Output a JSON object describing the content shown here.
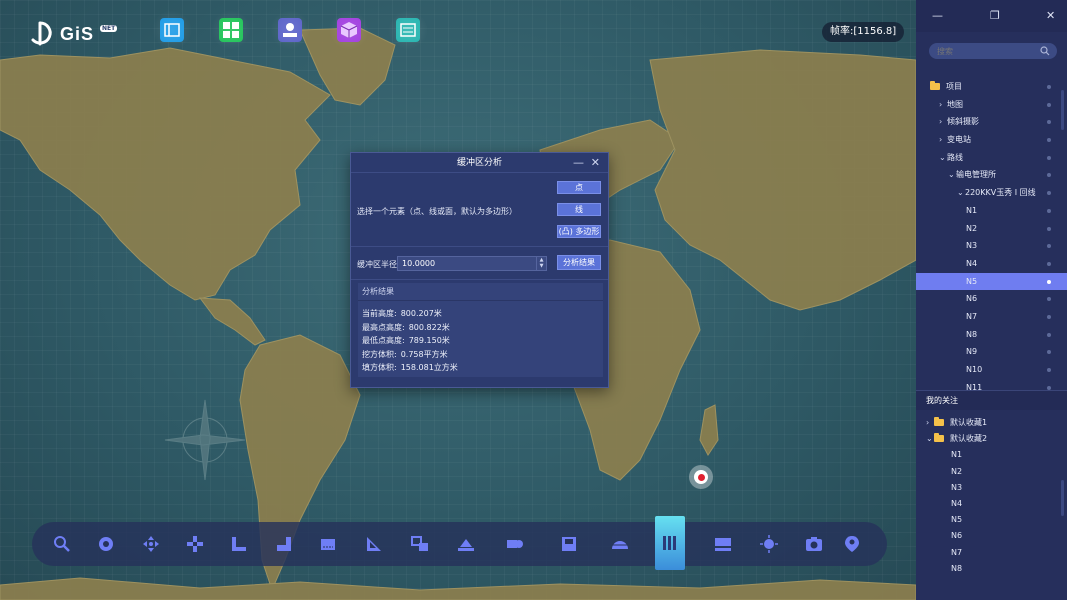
{
  "app": {
    "logo_text": "GiS",
    "logo_badge": "NET",
    "fps_label": "帧率:",
    "fps_value": "[1156.8]"
  },
  "top_icons": [
    {
      "name": "layer-panel-icon",
      "color": "#1d9be6"
    },
    {
      "name": "grid-apps-icon",
      "color": "#22c45a"
    },
    {
      "name": "map-marker-layer-icon",
      "color": "#5b63c9"
    },
    {
      "name": "cube-3d-icon",
      "color": "#a23fe0"
    },
    {
      "name": "document-panel-icon",
      "color": "#27b5b0"
    }
  ],
  "dialog": {
    "title": "缓冲区分析",
    "select_label": "选择一个元素（点、线或面，默认为多边形）",
    "btn_point": "点",
    "btn_line": "线",
    "btn_polygon": "(凸) 多边形",
    "radius_label": "缓冲区半径",
    "radius_value": "10.0000",
    "analyze_btn": "分析结果",
    "result_header": "分析结果",
    "results": [
      {
        "key": "当前高度:",
        "value": "800.207米"
      },
      {
        "key": "最高点高度:",
        "value": "800.822米"
      },
      {
        "key": "最低点高度:",
        "value": "789.150米"
      },
      {
        "key": "挖方体积:",
        "value": "0.758平方米"
      },
      {
        "key": "填方体积:",
        "value": "158.081立方米"
      }
    ]
  },
  "toolbar": [
    {
      "name": "search-tool-icon"
    },
    {
      "name": "rotate-tool-icon"
    },
    {
      "name": "pan-tool-icon"
    },
    {
      "name": "crosshair-tool-icon"
    },
    {
      "name": "measure-height-icon"
    },
    {
      "name": "measure-area-icon"
    },
    {
      "name": "measure-distance-icon"
    },
    {
      "name": "triangle-measure-icon"
    },
    {
      "name": "overlay-analysis-icon"
    },
    {
      "name": "shelter-analysis-icon"
    },
    {
      "name": "flood-analysis-icon"
    },
    {
      "name": "save-view-icon"
    },
    {
      "name": "dome-analysis-icon"
    },
    {
      "name": "buffer-analysis-icon"
    },
    {
      "name": "profile-analysis-icon"
    },
    {
      "name": "light-icon"
    },
    {
      "name": "screenshot-icon"
    },
    {
      "name": "location-pin-icon"
    }
  ],
  "sidebar": {
    "search_placeholder": "搜索",
    "tree": [
      {
        "label": "项目",
        "level": 0,
        "type": "folder"
      },
      {
        "label": "地图",
        "level": 1,
        "type": "collapsed"
      },
      {
        "label": "倾斜摄影",
        "level": 1,
        "type": "collapsed"
      },
      {
        "label": "变电站",
        "level": 1,
        "type": "collapsed"
      },
      {
        "label": "路线",
        "level": 1,
        "type": "expanded"
      },
      {
        "label": "输电管理所",
        "level": 2,
        "type": "expanded"
      },
      {
        "label": "220KKV玉秀 I 回线",
        "level": 3,
        "type": "expanded"
      },
      {
        "label": "N1",
        "level": 4,
        "type": "leaf"
      },
      {
        "label": "N2",
        "level": 4,
        "type": "leaf"
      },
      {
        "label": "N3",
        "level": 4,
        "type": "leaf"
      },
      {
        "label": "N4",
        "level": 4,
        "type": "leaf"
      },
      {
        "label": "N5",
        "level": 4,
        "type": "leaf",
        "selected": true
      },
      {
        "label": "N6",
        "level": 4,
        "type": "leaf"
      },
      {
        "label": "N7",
        "level": 4,
        "type": "leaf"
      },
      {
        "label": "N8",
        "level": 4,
        "type": "leaf"
      },
      {
        "label": "N9",
        "level": 4,
        "type": "leaf"
      },
      {
        "label": "N10",
        "level": 4,
        "type": "leaf"
      },
      {
        "label": "N11",
        "level": 4,
        "type": "leaf"
      }
    ],
    "favorites_title": "我的关注",
    "favorites": [
      {
        "label": "默认收藏1",
        "level": 0,
        "type": "folder-collapsed"
      },
      {
        "label": "默认收藏2",
        "level": 0,
        "type": "folder-expanded"
      },
      {
        "label": "N1",
        "level": 1,
        "type": "leaf"
      },
      {
        "label": "N2",
        "level": 1,
        "type": "leaf"
      },
      {
        "label": "N3",
        "level": 1,
        "type": "leaf"
      },
      {
        "label": "N4",
        "level": 1,
        "type": "leaf"
      },
      {
        "label": "N5",
        "level": 1,
        "type": "leaf"
      },
      {
        "label": "N6",
        "level": 1,
        "type": "leaf"
      },
      {
        "label": "N7",
        "level": 1,
        "type": "leaf"
      },
      {
        "label": "N8",
        "level": 1,
        "type": "leaf"
      }
    ]
  }
}
